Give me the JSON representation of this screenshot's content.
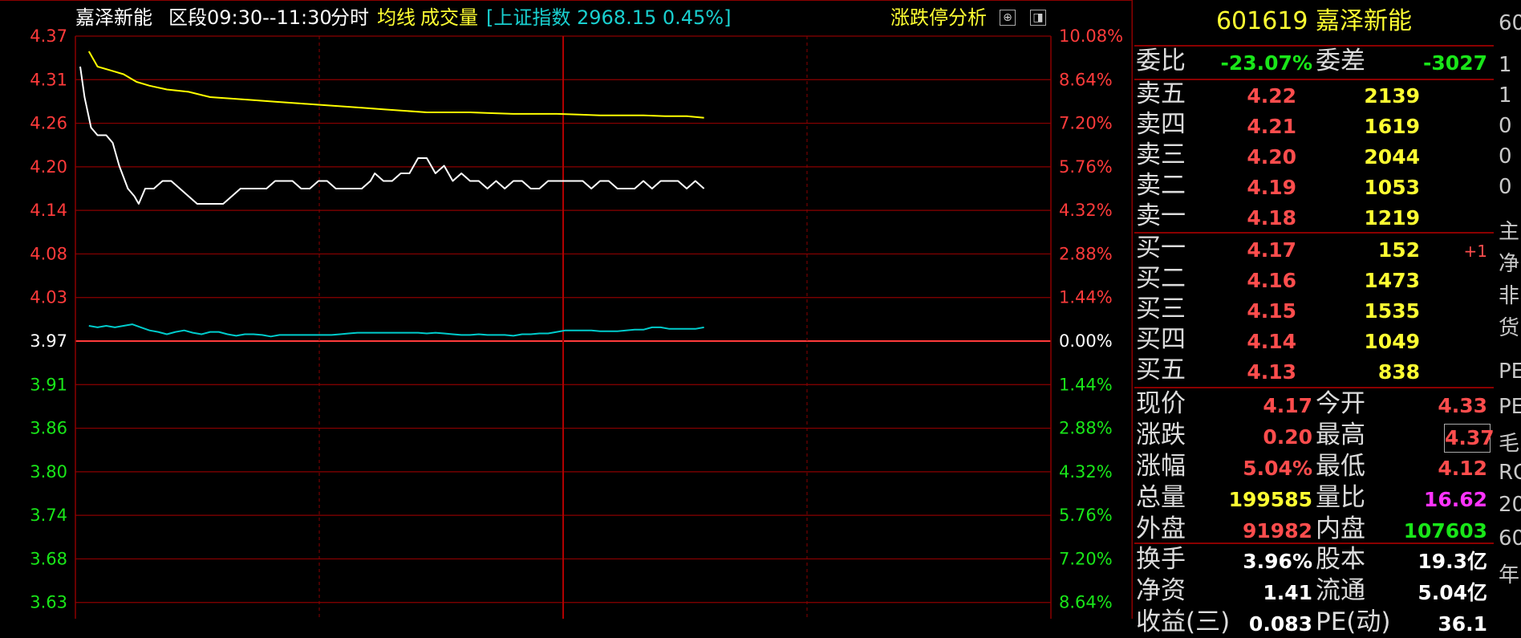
{
  "header": {
    "stock_name": "嘉泽新能",
    "range": "区段09:30--11:30",
    "mode": "分时",
    "avg_line": "均线",
    "volume": "成交量",
    "index_info": "[上证指数 2968.15 0.45%]",
    "limit_analysis": "涨跌停分析",
    "btn_up": "⊕",
    "btn_panel": "◨"
  },
  "axes": {
    "left_red": [
      "4.37",
      "4.31",
      "4.26",
      "4.20",
      "4.14",
      "4.08",
      "4.03"
    ],
    "left_mid": "3.97",
    "left_green": [
      "3.91",
      "3.86",
      "3.80",
      "3.74",
      "3.68",
      "3.63"
    ],
    "right_red": [
      "10.08%",
      "8.64%",
      "7.20%",
      "5.76%",
      "4.32%",
      "2.88%",
      "1.44%"
    ],
    "right_mid": "0.00%",
    "right_green": [
      "1.44%",
      "2.88%",
      "4.32%",
      "5.76%",
      "7.20%",
      "8.64%"
    ]
  },
  "chart_data": {
    "type": "line",
    "ylim": [
      3.63,
      4.37
    ],
    "reference_price": 3.97,
    "x_range_minutes": [
      0,
      240
    ],
    "series": [
      {
        "color": "#ffffff",
        "values": [
          [
            0,
            4.33
          ],
          [
            2,
            4.29
          ],
          [
            5,
            4.25
          ],
          [
            8,
            4.24
          ],
          [
            12,
            4.24
          ],
          [
            15,
            4.23
          ],
          [
            18,
            4.2
          ],
          [
            22,
            4.17
          ],
          [
            25,
            4.16
          ],
          [
            27,
            4.15
          ],
          [
            30,
            4.17
          ],
          [
            34,
            4.17
          ],
          [
            38,
            4.18
          ],
          [
            42,
            4.18
          ],
          [
            46,
            4.17
          ],
          [
            50,
            4.16
          ],
          [
            54,
            4.15
          ],
          [
            58,
            4.15
          ],
          [
            62,
            4.15
          ],
          [
            66,
            4.15
          ],
          [
            70,
            4.16
          ],
          [
            74,
            4.17
          ],
          [
            80,
            4.17
          ],
          [
            86,
            4.17
          ],
          [
            90,
            4.18
          ],
          [
            94,
            4.18
          ],
          [
            98,
            4.18
          ],
          [
            102,
            4.17
          ],
          [
            106,
            4.17
          ],
          [
            110,
            4.18
          ],
          [
            114,
            4.18
          ],
          [
            118,
            4.17
          ],
          [
            122,
            4.17
          ],
          [
            126,
            4.17
          ],
          [
            130,
            4.17
          ],
          [
            134,
            4.18
          ],
          [
            136,
            4.19
          ],
          [
            140,
            4.18
          ],
          [
            144,
            4.18
          ],
          [
            148,
            4.19
          ],
          [
            152,
            4.19
          ],
          [
            156,
            4.21
          ],
          [
            160,
            4.21
          ],
          [
            164,
            4.19
          ],
          [
            168,
            4.2
          ],
          [
            172,
            4.18
          ],
          [
            176,
            4.19
          ],
          [
            180,
            4.18
          ],
          [
            184,
            4.18
          ],
          [
            188,
            4.17
          ],
          [
            192,
            4.18
          ],
          [
            196,
            4.17
          ],
          [
            200,
            4.18
          ],
          [
            204,
            4.18
          ],
          [
            208,
            4.17
          ],
          [
            212,
            4.17
          ],
          [
            216,
            4.18
          ],
          [
            220,
            4.18
          ],
          [
            224,
            4.18
          ],
          [
            228,
            4.18
          ],
          [
            232,
            4.18
          ],
          [
            236,
            4.17
          ],
          [
            240,
            4.18
          ],
          [
            244,
            4.18
          ],
          [
            248,
            4.17
          ],
          [
            252,
            4.17
          ],
          [
            256,
            4.17
          ],
          [
            260,
            4.18
          ],
          [
            264,
            4.17
          ],
          [
            268,
            4.18
          ],
          [
            272,
            4.18
          ],
          [
            276,
            4.18
          ],
          [
            280,
            4.17
          ],
          [
            284,
            4.18
          ],
          [
            288,
            4.17
          ]
        ]
      },
      {
        "color": "#ffff00",
        "values": [
          [
            4,
            4.35
          ],
          [
            8,
            4.33
          ],
          [
            14,
            4.325
          ],
          [
            20,
            4.32
          ],
          [
            26,
            4.31
          ],
          [
            32,
            4.305
          ],
          [
            40,
            4.3
          ],
          [
            50,
            4.297
          ],
          [
            60,
            4.29
          ],
          [
            70,
            4.288
          ],
          [
            80,
            4.286
          ],
          [
            90,
            4.284
          ],
          [
            100,
            4.282
          ],
          [
            110,
            4.28
          ],
          [
            120,
            4.278
          ],
          [
            130,
            4.276
          ],
          [
            140,
            4.274
          ],
          [
            150,
            4.272
          ],
          [
            160,
            4.27
          ],
          [
            170,
            4.27
          ],
          [
            180,
            4.27
          ],
          [
            190,
            4.269
          ],
          [
            200,
            4.268
          ],
          [
            210,
            4.268
          ],
          [
            220,
            4.268
          ],
          [
            230,
            4.267
          ],
          [
            240,
            4.266
          ],
          [
            250,
            4.266
          ],
          [
            260,
            4.266
          ],
          [
            270,
            4.265
          ],
          [
            280,
            4.265
          ],
          [
            288,
            4.263
          ]
        ]
      }
    ]
  },
  "index_line": {
    "color": "#00cccc",
    "values": [
      [
        4,
        3.99
      ],
      [
        8,
        3.988
      ],
      [
        12,
        3.99
      ],
      [
        16,
        3.988
      ],
      [
        20,
        3.99
      ],
      [
        24,
        3.992
      ],
      [
        28,
        3.988
      ],
      [
        32,
        3.984
      ],
      [
        36,
        3.982
      ],
      [
        40,
        3.979
      ],
      [
        44,
        3.982
      ],
      [
        48,
        3.984
      ],
      [
        52,
        3.981
      ],
      [
        56,
        3.979
      ],
      [
        60,
        3.982
      ],
      [
        64,
        3.982
      ],
      [
        68,
        3.979
      ],
      [
        72,
        3.977
      ],
      [
        76,
        3.979
      ],
      [
        80,
        3.979
      ],
      [
        84,
        3.978
      ],
      [
        88,
        3.976
      ],
      [
        92,
        3.978
      ],
      [
        96,
        3.978
      ],
      [
        100,
        3.978
      ],
      [
        104,
        3.978
      ],
      [
        108,
        3.978
      ],
      [
        112,
        3.978
      ],
      [
        116,
        3.978
      ],
      [
        120,
        3.979
      ],
      [
        124,
        3.98
      ],
      [
        128,
        3.981
      ],
      [
        132,
        3.981
      ],
      [
        136,
        3.981
      ],
      [
        140,
        3.981
      ],
      [
        144,
        3.981
      ],
      [
        148,
        3.981
      ],
      [
        152,
        3.981
      ],
      [
        156,
        3.981
      ],
      [
        160,
        3.98
      ],
      [
        164,
        3.981
      ],
      [
        168,
        3.98
      ],
      [
        172,
        3.979
      ],
      [
        176,
        3.978
      ],
      [
        180,
        3.978
      ],
      [
        184,
        3.979
      ],
      [
        188,
        3.978
      ],
      [
        192,
        3.978
      ],
      [
        196,
        3.978
      ],
      [
        200,
        3.977
      ],
      [
        204,
        3.979
      ],
      [
        208,
        3.979
      ],
      [
        212,
        3.98
      ],
      [
        216,
        3.98
      ],
      [
        220,
        3.982
      ],
      [
        224,
        3.984
      ],
      [
        228,
        3.984
      ],
      [
        232,
        3.984
      ],
      [
        236,
        3.984
      ],
      [
        240,
        3.983
      ],
      [
        244,
        3.983
      ],
      [
        248,
        3.983
      ],
      [
        252,
        3.984
      ],
      [
        256,
        3.985
      ],
      [
        260,
        3.985
      ],
      [
        264,
        3.988
      ],
      [
        268,
        3.988
      ],
      [
        272,
        3.986
      ],
      [
        276,
        3.986
      ],
      [
        280,
        3.986
      ],
      [
        284,
        3.986
      ],
      [
        288,
        3.988
      ]
    ]
  },
  "panel": {
    "title": "601619 嘉泽新能",
    "weibi_label": "委比",
    "weibi_value": "-23.07%",
    "weicha_label": "委差",
    "weicha_value": "-3027",
    "sells": [
      {
        "label": "卖五",
        "price": "4.22",
        "vol": "2139"
      },
      {
        "label": "卖四",
        "price": "4.21",
        "vol": "1619"
      },
      {
        "label": "卖三",
        "price": "4.20",
        "vol": "2044"
      },
      {
        "label": "卖二",
        "price": "4.19",
        "vol": "1053"
      },
      {
        "label": "卖一",
        "price": "4.18",
        "vol": "1219"
      }
    ],
    "buys": [
      {
        "label": "买一",
        "price": "4.17",
        "vol": "152",
        "extra": "+1"
      },
      {
        "label": "买二",
        "price": "4.16",
        "vol": "1473",
        "extra": ""
      },
      {
        "label": "买三",
        "price": "4.15",
        "vol": "1535",
        "extra": ""
      },
      {
        "label": "买四",
        "price": "4.14",
        "vol": "1049",
        "extra": ""
      },
      {
        "label": "买五",
        "price": "4.13",
        "vol": "838",
        "extra": ""
      }
    ],
    "stats": [
      {
        "l1": "现价",
        "v1": "4.17",
        "c1": "red",
        "l2": "今开",
        "v2": "4.33",
        "c2": "red"
      },
      {
        "l1": "涨跌",
        "v1": "0.20",
        "c1": "red",
        "l2": "最高",
        "v2": "4.37",
        "c2": "red"
      },
      {
        "l1": "涨幅",
        "v1": "5.04%",
        "c1": "red",
        "l2": "最低",
        "v2": "4.12",
        "c2": "red"
      },
      {
        "l1": "总量",
        "v1": "199585",
        "c1": "yellow",
        "l2": "量比",
        "v2": "16.62",
        "c2": "magenta"
      },
      {
        "l1": "外盘",
        "v1": "91982",
        "c1": "red",
        "l2": "内盘",
        "v2": "107603",
        "c2": "green"
      }
    ],
    "stats2": [
      {
        "l1": "换手",
        "v1": "3.96%",
        "c1": "white",
        "l2": "股本",
        "v2": "19.3亿",
        "c2": "white"
      },
      {
        "l1": "净资",
        "v1": "1.41",
        "c1": "white",
        "l2": "流通",
        "v2": "5.04亿",
        "c2": "white"
      },
      {
        "l1": "收益(三)",
        "v1": "0.083",
        "c1": "white",
        "l2": "PE(动)",
        "v2": "36.1",
        "c2": "white"
      }
    ]
  },
  "far_right": [
    "60",
    "1",
    "1",
    "0",
    "0",
    "0",
    "主",
    "净",
    "非",
    "货",
    "PE",
    "PE",
    "毛",
    "RO",
    "20",
    "60",
    "年"
  ]
}
